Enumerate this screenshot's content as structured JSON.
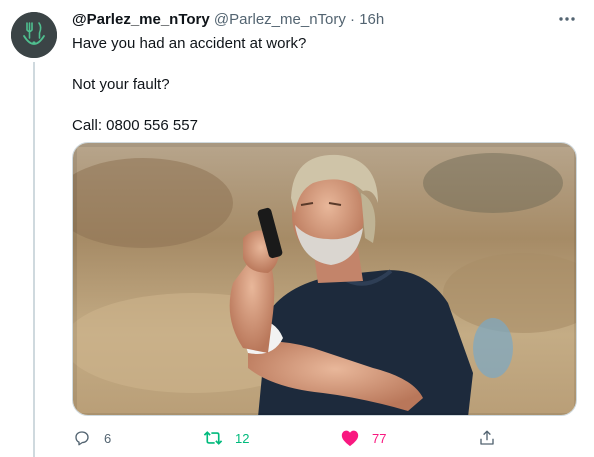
{
  "tweet": {
    "display_name": "@Parlez_me_nTory",
    "handle": "@Parlez_me_nTory",
    "separator": "·",
    "time": "16h",
    "text_lines": [
      "Have you had an accident at work?",
      "Not your fault?",
      "Call: 0800 556 557"
    ]
  },
  "actions": {
    "reply_count": "6",
    "retweet_count": "12",
    "like_count": "77"
  },
  "icons": {
    "more": "more-horizontal-icon",
    "reply": "reply-icon",
    "retweet": "retweet-icon",
    "like": "heart-filled-icon",
    "share": "share-icon"
  },
  "colors": {
    "retweeted": "#00ba7c",
    "liked": "#f91880",
    "secondary_text": "#536471"
  }
}
